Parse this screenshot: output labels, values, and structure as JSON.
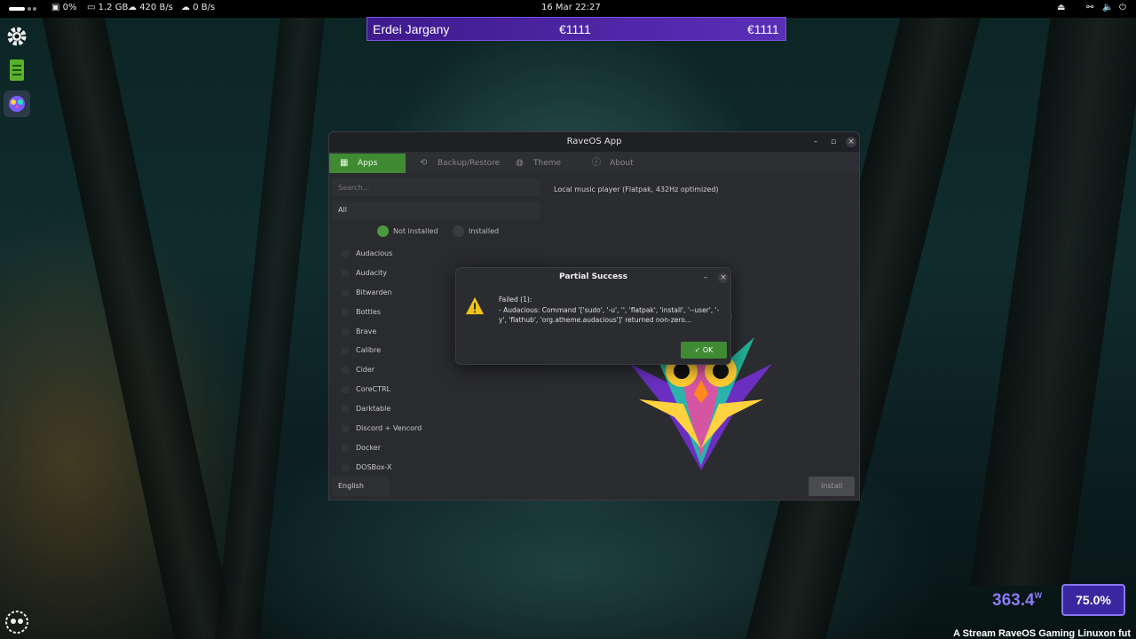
{
  "topbar": {
    "cpu": "0%",
    "ram": "1.2 GB",
    "down": "420 B/s",
    "up": "0 B/s",
    "clock": "16 Mar  22:27"
  },
  "banner": {
    "name": "Erdei Jargany",
    "value1": "€1111",
    "value2": "€1111"
  },
  "window": {
    "title": "RaveOS App",
    "tabs": [
      {
        "label": "Apps",
        "icon": "grid-icon"
      },
      {
        "label": "Backup/Restore",
        "icon": "history-icon"
      },
      {
        "label": "Theme",
        "icon": "palette-icon"
      },
      {
        "label": "About",
        "icon": "info-icon"
      }
    ],
    "search_placeholder": "Search...",
    "filter": "All",
    "radio_not_installed": "Not installed",
    "radio_installed": "Installed",
    "apps": [
      "Audacious",
      "Audacity",
      "Bitwarden",
      "Bottles",
      "Brave",
      "Calibre",
      "Cider",
      "CoreCTRL",
      "Darktable",
      "Discord + Vencord",
      "Docker",
      "DOSBox-X"
    ],
    "description": "Local music player (Flatpak, 432Hz optimized)",
    "language": "English",
    "install_label": "Install"
  },
  "dialog": {
    "title": "Partial Success",
    "heading": "Failed (1):",
    "message": " - Audacious: Command '['sudo', '-u', '', 'flatpak', 'install', '--user', '-y', 'flathub', 'org.atheme.audacious']' returned non-zero...",
    "ok_label": "OK"
  },
  "widgets": {
    "watts": "363.4",
    "watts_unit": "W",
    "battery": "75.0%",
    "ticker": "A Stream RaveOS Gaming Linuxon fut"
  },
  "colors": {
    "accent_green": "#3f8a33",
    "banner_purple": "#4a23a6",
    "widget_purple": "#8a7bf0"
  }
}
